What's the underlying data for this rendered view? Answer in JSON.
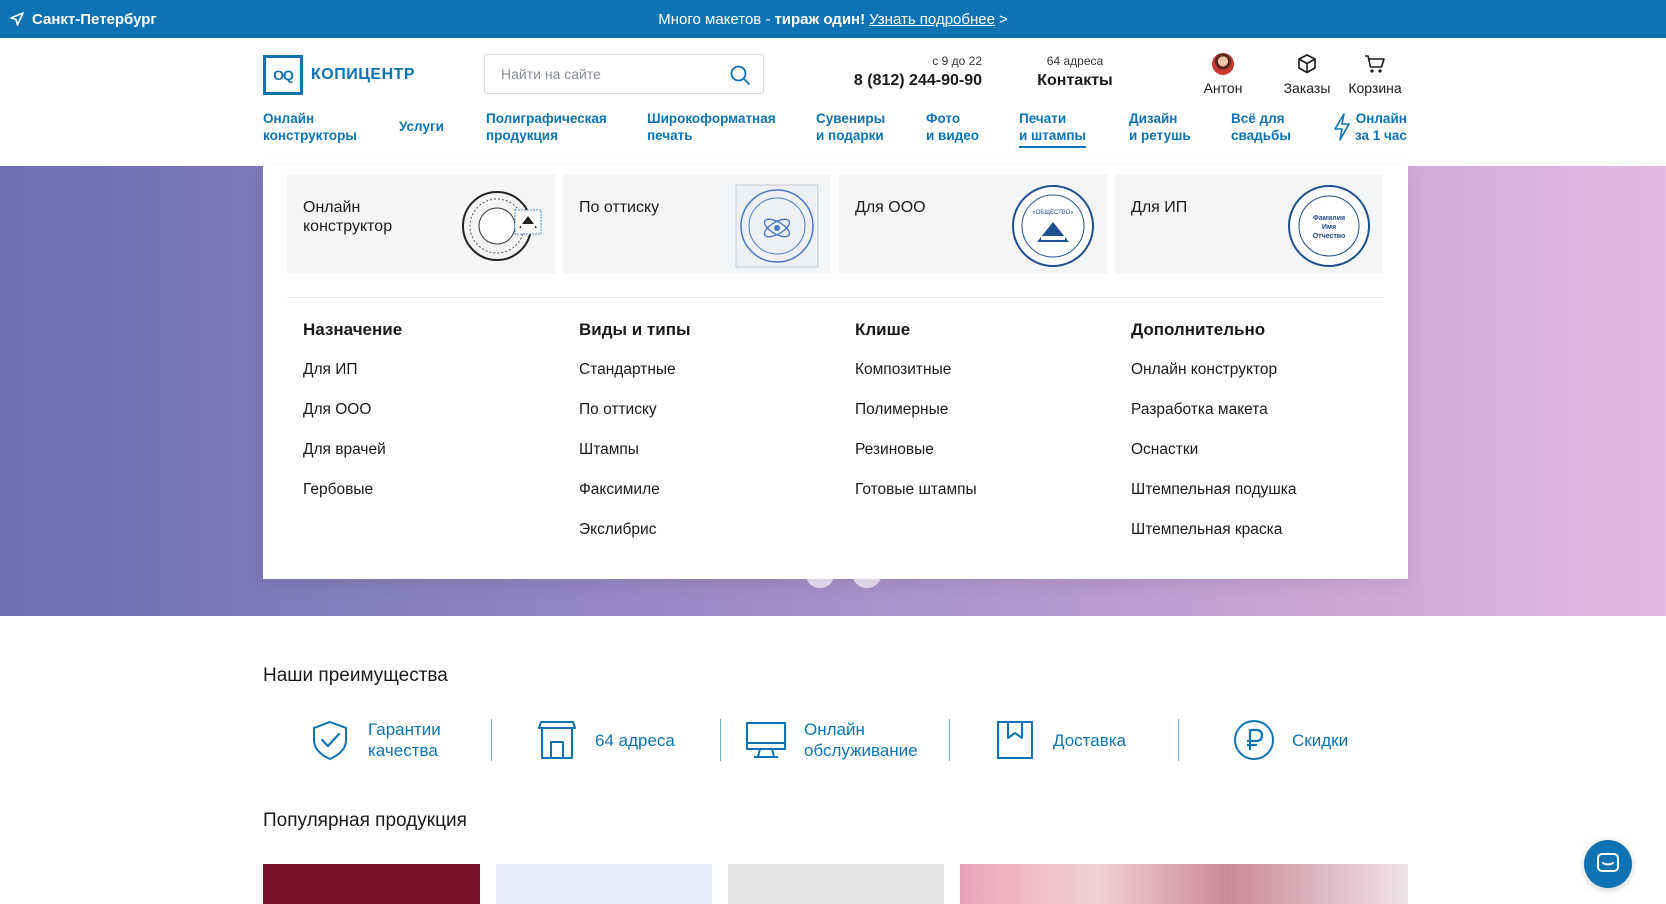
{
  "topbar": {
    "city": "Санкт-Петербург",
    "promo_text": "Много макетов -",
    "promo_bold": "тираж один!",
    "promo_link": "Узнать подробнее",
    "promo_arrow": ">"
  },
  "header": {
    "logo_mark": "OQ",
    "logo_name": "КОПИЦЕНТР",
    "search_placeholder": "Найти на сайте",
    "hours": "с 9 до 22",
    "phone": "8 (812) 244-90-90",
    "addresses": "64 адреса",
    "contacts": "Контакты",
    "user": "Антон",
    "orders": "Заказы",
    "cart": "Корзина"
  },
  "nav": {
    "items": [
      {
        "l1": "Онлайн",
        "l2": "конструкторы"
      },
      {
        "l1": "Услуги",
        "l2": ""
      },
      {
        "l1": "Полиграфическая",
        "l2": "продукция"
      },
      {
        "l1": "Широкоформатная",
        "l2": "печать"
      },
      {
        "l1": "Сувениры",
        "l2": "и подарки"
      },
      {
        "l1": "Фото",
        "l2": "и видео"
      },
      {
        "l1": "Печати",
        "l2": "и штампы"
      },
      {
        "l1": "Дизайн",
        "l2": "и ретушь"
      },
      {
        "l1": "Всё для",
        "l2": "свадьбы"
      },
      {
        "l1": "Онлайн",
        "l2": "за 1 час"
      }
    ],
    "active_index": 6
  },
  "mega": {
    "cards": [
      {
        "title": "Онлайн конструктор"
      },
      {
        "title": "По оттиску"
      },
      {
        "title": "Для ООО"
      },
      {
        "title": "Для ИП"
      }
    ],
    "stamp_texts": {
      "ooo": "«ОБЩЕСТВО»",
      "ip_l1": "Фамилия",
      "ip_l2": "Имя",
      "ip_l3": "Отчество"
    },
    "columns": [
      {
        "head": "Назначение",
        "links": [
          "Для ИП",
          "Для ООО",
          "Для врачей",
          "Гербовые"
        ]
      },
      {
        "head": "Виды и типы",
        "links": [
          "Стандартные",
          "По оттиску",
          "Штампы",
          "Факсимиле",
          "Экслибрис"
        ]
      },
      {
        "head": "Клише",
        "links": [
          "Композитные",
          "Полимерные",
          "Резиновые",
          "Готовые штампы"
        ]
      },
      {
        "head": "Дополнительно",
        "links": [
          "Онлайн конструктор",
          "Разработка макета",
          "Оснастки",
          "Штемпельная подушка",
          "Штемпельная краска"
        ]
      }
    ]
  },
  "advantages": {
    "title": "Наши преимущества",
    "items": [
      {
        "l1": "Гарантии",
        "l2": "качества",
        "icon": "shield-check-icon"
      },
      {
        "l1": "64 адреса",
        "l2": "",
        "icon": "store-icon"
      },
      {
        "l1": "Онлайн",
        "l2": "обслуживание",
        "icon": "monitor-icon"
      },
      {
        "l1": "Доставка",
        "l2": "",
        "icon": "bookmark-box-icon"
      },
      {
        "l1": "Скидки",
        "l2": "",
        "icon": "ruble-icon"
      }
    ]
  },
  "popular": {
    "title": "Популярная продукция"
  },
  "colors": {
    "brand": "#0d73b3",
    "banner_start": "#6e6eb3",
    "banner_end": "#e7b8e0"
  }
}
